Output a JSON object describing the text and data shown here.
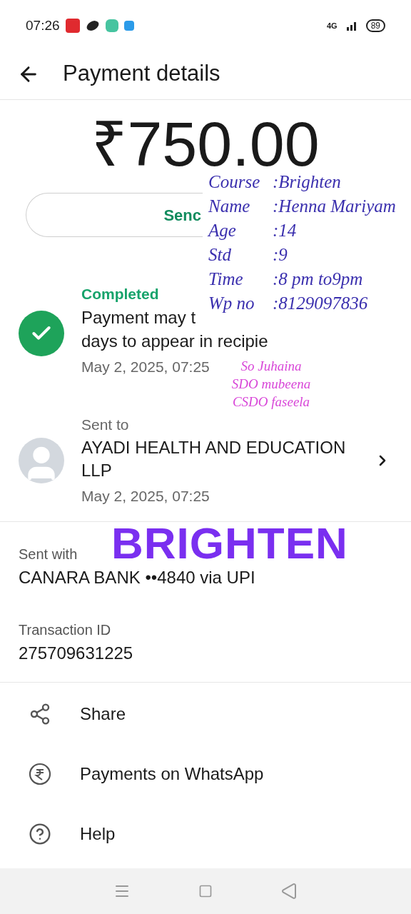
{
  "status_bar": {
    "time": "07:26",
    "network": "4G",
    "battery": "89"
  },
  "header": {
    "title": "Payment details"
  },
  "amount": "₹750.00",
  "send_button": {
    "label": "Senc"
  },
  "status": {
    "label": "Completed",
    "message_lines": [
      "Payment may t",
      "days to appear in recipie"
    ],
    "date": "May 2, 2025, 07:25"
  },
  "recipient": {
    "heading": "Sent to",
    "name": "AYADI HEALTH AND EDUCATION LLP",
    "date": "May 2, 2025, 07:25"
  },
  "sent_with": {
    "label": "Sent with",
    "value": "CANARA BANK ••4840 via UPI"
  },
  "transaction": {
    "label": "Transaction ID",
    "value": "275709631225"
  },
  "actions": [
    {
      "kind": "share",
      "label": "Share"
    },
    {
      "kind": "rupee",
      "label": "Payments on WhatsApp"
    },
    {
      "kind": "help",
      "label": "Help"
    }
  ],
  "annotation": {
    "details": [
      {
        "label": "Course",
        "value": ":Brighten"
      },
      {
        "label": "Name",
        "value": ":Henna Mariyam"
      },
      {
        "label": "Age",
        "value": ":14"
      },
      {
        "label": "Std",
        "value": ":9"
      },
      {
        "label": "Time",
        "value": ":8 pm to9pm"
      },
      {
        "label": "Wp no",
        "value": ":8129097836"
      }
    ],
    "staff": [
      "So Juhaina",
      "SDO mubeena",
      "CSDO faseela"
    ],
    "banner": "BRIGHTEN"
  }
}
